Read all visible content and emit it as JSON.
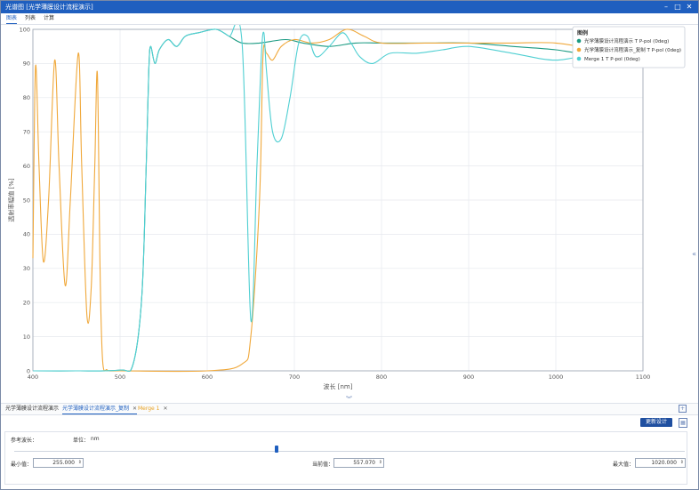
{
  "window": {
    "title": "光谱图 [光学薄膜设计流程演示]"
  },
  "tabs": [
    "图表",
    "列表",
    "计算"
  ],
  "chart_data": {
    "type": "line",
    "title": "",
    "xlabel": "波长 [nm]",
    "ylabel": "透射率幅值 [%]",
    "xlim": [
      400,
      1100
    ],
    "ylim": [
      0,
      100
    ],
    "x_ticks": [
      400,
      500,
      600,
      700,
      800,
      900,
      1000,
      1100
    ],
    "y_ticks": [
      0,
      10,
      20,
      30,
      40,
      50,
      60,
      70,
      80,
      90,
      100
    ],
    "grid": true,
    "legend_title": "图例",
    "legend_position": "top-right",
    "series": [
      {
        "name": "光学薄膜设计流程演示 T P-pol (0deg)",
        "color": "#1a9a82",
        "points": [
          [
            400,
            0
          ],
          [
            450,
            0
          ],
          [
            500,
            0.2
          ],
          [
            515,
            2
          ],
          [
            525,
            22
          ],
          [
            530,
            60
          ],
          [
            533,
            88
          ],
          [
            535,
            95
          ],
          [
            540,
            90
          ],
          [
            545,
            94
          ],
          [
            555,
            97
          ],
          [
            565,
            95
          ],
          [
            575,
            98
          ],
          [
            590,
            99
          ],
          [
            610,
            100
          ],
          [
            625,
            98
          ],
          [
            640,
            96
          ],
          [
            660,
            96
          ],
          [
            690,
            97
          ],
          [
            710,
            96
          ],
          [
            740,
            95
          ],
          [
            770,
            96
          ],
          [
            800,
            96
          ],
          [
            850,
            96
          ],
          [
            900,
            96
          ],
          [
            950,
            95
          ],
          [
            1000,
            94
          ],
          [
            1050,
            92
          ],
          [
            1100,
            91
          ]
        ]
      },
      {
        "name": "光学薄膜设计流程演示_复制 T P-pol (0deg)",
        "color": "#f0a83a",
        "points": [
          [
            400,
            33
          ],
          [
            403,
            89
          ],
          [
            407,
            60
          ],
          [
            412,
            32
          ],
          [
            418,
            50
          ],
          [
            425,
            91
          ],
          [
            430,
            60
          ],
          [
            437,
            25
          ],
          [
            443,
            50
          ],
          [
            452,
            93
          ],
          [
            456,
            60
          ],
          [
            462,
            16
          ],
          [
            467,
            25
          ],
          [
            471,
            60
          ],
          [
            474,
            87
          ],
          [
            477,
            30
          ],
          [
            480,
            3
          ],
          [
            485,
            0.3
          ],
          [
            490,
            0
          ],
          [
            500,
            0
          ],
          [
            600,
            0
          ],
          [
            640,
            2
          ],
          [
            650,
            10
          ],
          [
            660,
            50
          ],
          [
            664,
            92
          ],
          [
            668,
            93
          ],
          [
            675,
            91
          ],
          [
            685,
            95
          ],
          [
            700,
            97
          ],
          [
            720,
            96
          ],
          [
            740,
            97
          ],
          [
            760,
            100
          ],
          [
            780,
            98
          ],
          [
            800,
            96
          ],
          [
            850,
            96
          ],
          [
            900,
            96
          ],
          [
            950,
            96
          ],
          [
            1000,
            96
          ],
          [
            1050,
            94
          ],
          [
            1100,
            93
          ]
        ]
      },
      {
        "name": "Merge 1 T P-pol (0deg)",
        "color": "#4fcfd2",
        "points": [
          [
            400,
            0
          ],
          [
            450,
            0
          ],
          [
            500,
            0.2
          ],
          [
            515,
            2
          ],
          [
            525,
            22
          ],
          [
            530,
            60
          ],
          [
            533,
            88
          ],
          [
            535,
            95
          ],
          [
            540,
            90
          ],
          [
            545,
            94
          ],
          [
            555,
            97
          ],
          [
            565,
            95
          ],
          [
            575,
            98
          ],
          [
            590,
            99
          ],
          [
            610,
            100
          ],
          [
            625,
            98
          ],
          [
            640,
            96
          ],
          [
            650,
            15
          ],
          [
            657,
            60
          ],
          [
            662,
            92
          ],
          [
            665,
            99
          ],
          [
            668,
            88
          ],
          [
            675,
            70
          ],
          [
            685,
            68
          ],
          [
            695,
            80
          ],
          [
            705,
            96
          ],
          [
            715,
            98
          ],
          [
            725,
            92
          ],
          [
            740,
            95
          ],
          [
            755,
            99
          ],
          [
            765,
            96
          ],
          [
            775,
            92
          ],
          [
            790,
            90
          ],
          [
            810,
            93
          ],
          [
            840,
            93
          ],
          [
            870,
            94
          ],
          [
            900,
            95
          ],
          [
            950,
            93
          ],
          [
            1000,
            91
          ],
          [
            1050,
            93
          ],
          [
            1100,
            92
          ]
        ]
      }
    ]
  },
  "bottom_tabs": [
    {
      "label": "光学薄膜设计流程演示"
    },
    {
      "label": "光学薄膜设计流程演示_复制"
    },
    {
      "label": "Merge 1"
    }
  ],
  "update_button": "更新设计",
  "controls": {
    "ref_wavelength_label": "参考波长：",
    "unit_label": "单位：",
    "unit_value": "nm",
    "min_label": "最小值：",
    "min_value": "255.000",
    "current_label": "当前值：",
    "current_value": "557.070",
    "max_label": "最大值：",
    "max_value": "1020.000"
  }
}
